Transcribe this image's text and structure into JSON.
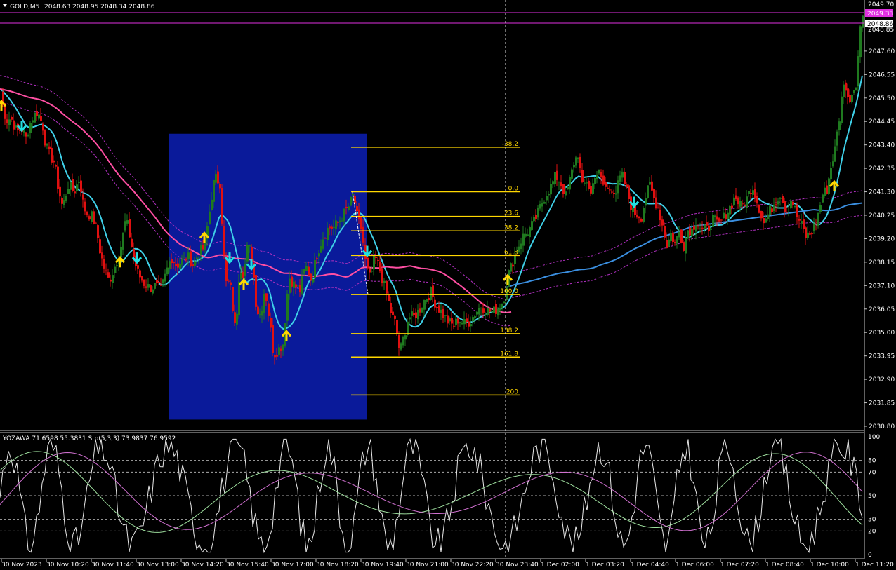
{
  "header": {
    "symbol": "GOLD,M5",
    "ohlc": "2048.63 2048.95 2048.34 2048.86"
  },
  "price_tags": {
    "top": "2049.70",
    "ask": "2049.33",
    "bid": "2048.86",
    "partial": "2048.85"
  },
  "oscillator": {
    "header": "YOZAWA 71.6598 55.3831  Sto(5,3,3) 73.9837 76.9592",
    "levels": [
      "100",
      "80",
      "70",
      "50",
      "30",
      "20",
      "0"
    ]
  },
  "colors": {
    "background": "#000000",
    "bull": "#1f7a1f",
    "bear": "#e01010",
    "box": "#0a1a9a",
    "fib": "#ffd700",
    "ma_fast": "#3fd0e8",
    "ma_mid": "#ff4fa3",
    "ma_slow": "#3b8fe0",
    "envelope": "#b030c0",
    "arrow_up": "#ffd700",
    "arrow_down": "#20e0e0"
  },
  "chart_data": {
    "type": "candlestick",
    "y_ticks": [
      "2049.70",
      "2047.60",
      "2046.55",
      "2045.50",
      "2044.45",
      "2043.40",
      "2042.35",
      "2041.30",
      "2040.25",
      "2039.20",
      "2038.15",
      "2037.10",
      "2036.05",
      "2035.00",
      "2033.95",
      "2032.90",
      "2031.85",
      "2030.80"
    ],
    "ylim": [
      2030.5,
      2049.9
    ],
    "x_ticks": [
      "30 Nov 2023",
      "30 Nov 10:20",
      "30 Nov 11:40",
      "30 Nov 13:00",
      "30 Nov 14:20",
      "30 Nov 15:40",
      "30 Nov 17:00",
      "30 Nov 18:20",
      "30 Nov 19:40",
      "30 Nov 21:00",
      "30 Nov 22:20",
      "30 Nov 23:40",
      "1 Dec 02:00",
      "1 Dec 03:20",
      "1 Dec 04:40",
      "1 Dec 06:00",
      "1 Dec 07:20",
      "1 Dec 08:40",
      "1 Dec 10:00",
      "1 Dec 11:20"
    ],
    "fibonacci": {
      "levels": [
        {
          "label": "-38.2",
          "price": 2043.3
        },
        {
          "label": "0.0",
          "price": 2041.3
        },
        {
          "label": "23.6",
          "price": 2040.2
        },
        {
          "label": "38.2",
          "price": 2039.55
        },
        {
          "label": "61.8",
          "price": 2038.45
        },
        {
          "label": "100.0",
          "price": 2036.7
        },
        {
          "label": "138.2",
          "price": 2034.95
        },
        {
          "label": "161.8",
          "price": 2033.9
        },
        {
          "label": "200",
          "price": 2032.2
        }
      ]
    },
    "horizontal_lines": [
      2049.33,
      2048.86
    ],
    "close_path": [
      [
        0,
        2045.9
      ],
      [
        4,
        2045.0
      ],
      [
        8,
        2044.5
      ],
      [
        14,
        2044.6
      ],
      [
        22,
        2044.0
      ],
      [
        30,
        2044.1
      ],
      [
        36,
        2043.7
      ],
      [
        44,
        2044.6
      ],
      [
        52,
        2044.9
      ],
      [
        60,
        2044.2
      ],
      [
        64,
        2043.4
      ],
      [
        70,
        2042.9
      ],
      [
        76,
        2042.6
      ],
      [
        82,
        2041.4
      ],
      [
        88,
        2040.6
      ],
      [
        96,
        2041.6
      ],
      [
        104,
        2041.3
      ],
      [
        112,
        2041.9
      ],
      [
        118,
        2040.6
      ],
      [
        124,
        2040.3
      ],
      [
        130,
        2040.2
      ],
      [
        136,
        2039.6
      ],
      [
        142,
        2038.5
      ],
      [
        148,
        2037.8
      ],
      [
        154,
        2037.3
      ],
      [
        160,
        2037.8
      ],
      [
        166,
        2038.3
      ],
      [
        172,
        2039.0
      ],
      [
        178,
        2040.1
      ],
      [
        184,
        2039.2
      ],
      [
        190,
        2038.2
      ],
      [
        196,
        2037.6
      ],
      [
        204,
        2037.2
      ],
      [
        212,
        2037.0
      ],
      [
        220,
        2037.1
      ],
      [
        228,
        2036.9
      ],
      [
        234,
        2037.5
      ],
      [
        242,
        2038.4
      ],
      [
        250,
        2038.0
      ],
      [
        258,
        2038.2
      ],
      [
        266,
        2038.4
      ],
      [
        274,
        2038.0
      ],
      [
        282,
        2038.6
      ],
      [
        290,
        2038.8
      ],
      [
        296,
        2040.2
      ],
      [
        302,
        2041.6
      ],
      [
        306,
        2041.9
      ],
      [
        312,
        2041.7
      ],
      [
        316,
        2039.5
      ],
      [
        320,
        2037.2
      ],
      [
        326,
        2037.2
      ],
      [
        334,
        2035.0
      ],
      [
        340,
        2038.0
      ],
      [
        346,
        2037.6
      ],
      [
        352,
        2039.0
      ],
      [
        358,
        2038.2
      ],
      [
        364,
        2036.0
      ],
      [
        370,
        2035.8
      ],
      [
        376,
        2037.0
      ],
      [
        382,
        2035.6
      ],
      [
        388,
        2034.0
      ],
      [
        394,
        2034.2
      ],
      [
        402,
        2034.5
      ],
      [
        410,
        2037.5
      ],
      [
        418,
        2037.1
      ],
      [
        426,
        2036.9
      ],
      [
        434,
        2038.0
      ],
      [
        442,
        2037.3
      ],
      [
        450,
        2038.5
      ],
      [
        458,
        2039.2
      ],
      [
        466,
        2039.7
      ],
      [
        474,
        2039.7
      ],
      [
        482,
        2040.0
      ],
      [
        490,
        2040.4
      ],
      [
        496,
        2040.7
      ],
      [
        502,
        2041.2
      ],
      [
        508,
        2040.0
      ],
      [
        514,
        2039.6
      ],
      [
        520,
        2037.9
      ],
      [
        526,
        2037.4
      ],
      [
        532,
        2038.4
      ],
      [
        538,
        2038.0
      ],
      [
        544,
        2037.3
      ],
      [
        550,
        2036.6
      ],
      [
        556,
        2035.8
      ],
      [
        562,
        2035.4
      ],
      [
        568,
        2034.1
      ],
      [
        574,
        2034.8
      ],
      [
        580,
        2035.7
      ],
      [
        588,
        2035.7
      ],
      [
        596,
        2036.0
      ],
      [
        604,
        2036.5
      ],
      [
        612,
        2036.8
      ],
      [
        620,
        2036.2
      ],
      [
        628,
        2035.9
      ],
      [
        636,
        2035.5
      ],
      [
        644,
        2035.3
      ],
      [
        652,
        2035.6
      ],
      [
        660,
        2035.4
      ],
      [
        668,
        2035.5
      ],
      [
        676,
        2035.9
      ],
      [
        684,
        2036.2
      ],
      [
        692,
        2036.0
      ],
      [
        700,
        2035.9
      ],
      [
        708,
        2036.1
      ],
      [
        716,
        2036.4
      ],
      [
        722,
        2037.6
      ],
      [
        728,
        2038.1
      ],
      [
        736,
        2038.8
      ],
      [
        744,
        2039.3
      ],
      [
        752,
        2039.6
      ],
      [
        760,
        2040.0
      ],
      [
        768,
        2040.6
      ],
      [
        776,
        2041.2
      ],
      [
        784,
        2041.6
      ],
      [
        790,
        2042.0
      ],
      [
        796,
        2041.8
      ],
      [
        804,
        2041.1
      ],
      [
        810,
        2041.8
      ],
      [
        816,
        2042.6
      ],
      [
        822,
        2043.0
      ],
      [
        828,
        2041.5
      ],
      [
        834,
        2041.8
      ],
      [
        840,
        2041.2
      ],
      [
        846,
        2042.1
      ],
      [
        852,
        2042.1
      ],
      [
        858,
        2041.6
      ],
      [
        864,
        2041.4
      ],
      [
        870,
        2041.5
      ],
      [
        876,
        2041.3
      ],
      [
        884,
        2042.1
      ],
      [
        892,
        2041.2
      ],
      [
        900,
        2040.4
      ],
      [
        906,
        2040.3
      ],
      [
        912,
        2040.2
      ],
      [
        918,
        2041.1
      ],
      [
        924,
        2041.6
      ],
      [
        930,
        2041.0
      ],
      [
        936,
        2040.6
      ],
      [
        942,
        2039.8
      ],
      [
        948,
        2038.9
      ],
      [
        954,
        2039.4
      ],
      [
        960,
        2039.0
      ],
      [
        966,
        2039.5
      ],
      [
        972,
        2038.9
      ],
      [
        978,
        2039.6
      ],
      [
        984,
        2039.6
      ],
      [
        990,
        2040.0
      ],
      [
        998,
        2039.6
      ],
      [
        1006,
        2039.6
      ],
      [
        1014,
        2040.1
      ],
      [
        1022,
        2039.8
      ],
      [
        1030,
        2040.2
      ],
      [
        1038,
        2040.6
      ],
      [
        1046,
        2041.1
      ],
      [
        1054,
        2040.6
      ],
      [
        1062,
        2041.0
      ],
      [
        1070,
        2041.6
      ],
      [
        1078,
        2040.8
      ],
      [
        1086,
        2039.9
      ],
      [
        1094,
        2040.4
      ],
      [
        1102,
        2040.8
      ],
      [
        1110,
        2041.2
      ],
      [
        1118,
        2040.4
      ],
      [
        1126,
        2041.0
      ],
      [
        1134,
        2040.2
      ],
      [
        1140,
        2039.8
      ],
      [
        1146,
        2039.3
      ],
      [
        1152,
        2039.4
      ],
      [
        1158,
        2039.7
      ],
      [
        1164,
        2040.3
      ],
      [
        1170,
        2041.2
      ],
      [
        1176,
        2041.4
      ],
      [
        1182,
        2042.4
      ],
      [
        1188,
        2043.2
      ],
      [
        1194,
        2044.6
      ],
      [
        1200,
        2046.3
      ],
      [
        1206,
        2045.4
      ],
      [
        1212,
        2045.7
      ],
      [
        1218,
        2046.2
      ],
      [
        1224,
        2048.6
      ],
      [
        1228,
        2049.5
      ]
    ],
    "highlight_box": {
      "x_from": 240,
      "x_to": 523,
      "price_from": 2043.9,
      "price_to": 2031.1
    },
    "arrows_up": [
      [
        2,
        2045.2
      ],
      [
        171,
        2038.2
      ],
      [
        291,
        2039.3
      ],
      [
        347,
        2037.2
      ],
      [
        408,
        2034.9
      ],
      [
        723,
        2037.4
      ],
      [
        1188,
        2041.6
      ]
    ],
    "arrows_down": [
      [
        31,
        2044.2
      ],
      [
        195,
        2038.3
      ],
      [
        327,
        2038.3
      ],
      [
        358,
        2038.0
      ],
      [
        523,
        2038.6
      ],
      [
        903,
        2040.8
      ]
    ]
  }
}
